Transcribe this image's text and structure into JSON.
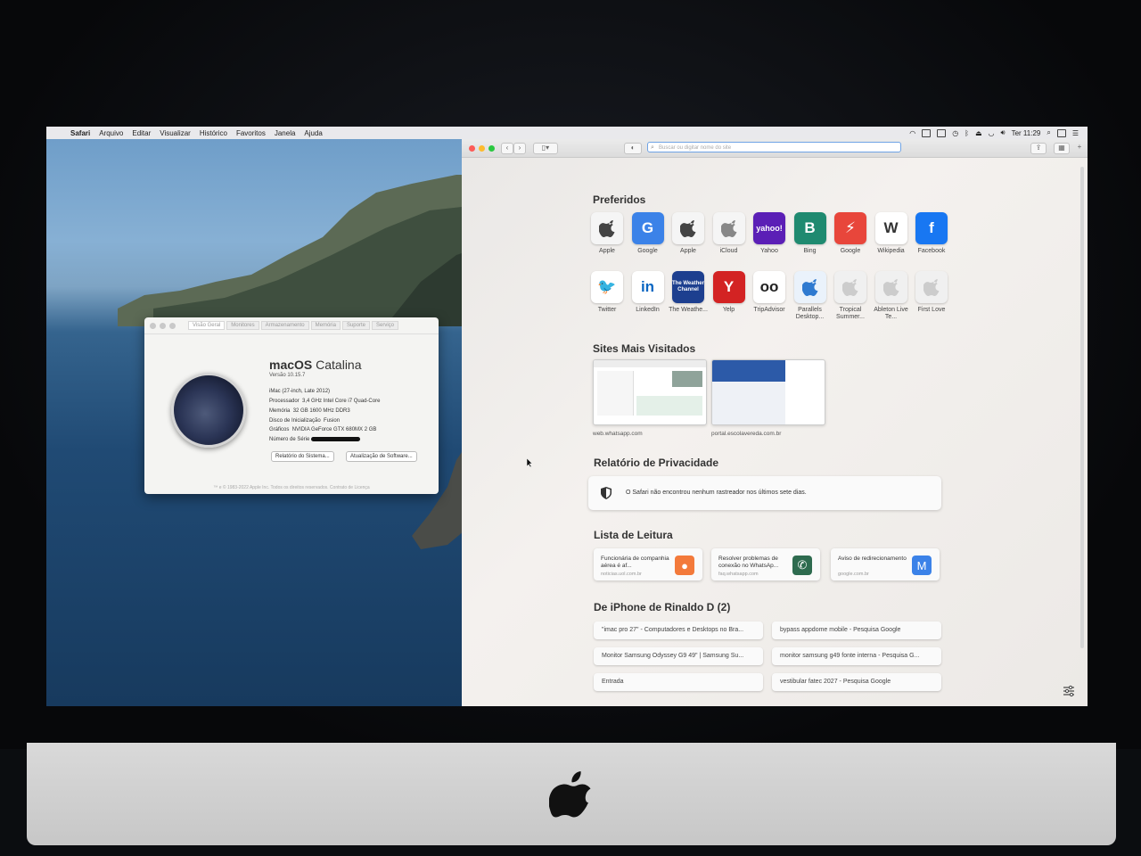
{
  "menubar": {
    "apple_icon": "apple-logo-icon",
    "items": [
      "Safari",
      "Arquivo",
      "Editar",
      "Visualizar",
      "Histórico",
      "Favoritos",
      "Janela",
      "Ajuda"
    ],
    "clock": "Ter 11:29"
  },
  "about": {
    "tabs": [
      "Visão Geral",
      "Monitores",
      "Armazenamento",
      "Memória",
      "Suporte",
      "Serviço"
    ],
    "title_bold": "macOS",
    "title_rest": "Catalina",
    "version": "Versão 10.15.7",
    "model": "iMac (27-inch, Late 2012)",
    "specs": [
      {
        "label": "Processador",
        "value": "3,4 GHz Intel Core i7 Quad-Core"
      },
      {
        "label": "Memória",
        "value": "32 GB 1600 MHz DDR3"
      },
      {
        "label": "Disco de Inicialização",
        "value": "Fusion"
      },
      {
        "label": "Gráficos",
        "value": "NVIDIA GeForce GTX 680MX 2 GB"
      }
    ],
    "serial_label": "Número de Série",
    "btn_report": "Relatório do Sistema...",
    "btn_update": "Atualização de Software...",
    "footer": "™ e © 1983-2022 Apple Inc. Todos os direitos reservados. Contrato de Licença"
  },
  "safari": {
    "url_placeholder": "Buscar ou digitar nome do site",
    "favorites_title": "Preferidos",
    "favorites": [
      {
        "label": "Apple",
        "bg": "#f5f5f5",
        "fg": "#444",
        "glyph": ""
      },
      {
        "label": "Google",
        "bg": "#3b82e8",
        "fg": "#ffffff",
        "glyph": "G"
      },
      {
        "label": "Apple",
        "bg": "#f5f5f5",
        "fg": "#444",
        "glyph": ""
      },
      {
        "label": "iCloud",
        "bg": "#f5f5f5",
        "fg": "#888",
        "glyph": ""
      },
      {
        "label": "Yahoo",
        "bg": "#5b1fb6",
        "fg": "#ffffff",
        "glyph": "yahoo!"
      },
      {
        "label": "Bing",
        "bg": "#1f8a70",
        "fg": "#ffffff",
        "glyph": "B"
      },
      {
        "label": "Google",
        "bg": "#e8463b",
        "fg": "#ffffff",
        "glyph": "⚡"
      },
      {
        "label": "Wikipedia",
        "bg": "#ffffff",
        "fg": "#333",
        "glyph": "W"
      },
      {
        "label": "Facebook",
        "bg": "#1877f2",
        "fg": "#ffffff",
        "glyph": "f"
      },
      {
        "label": "Twitter",
        "bg": "#ffffff",
        "fg": "#1da1f2",
        "glyph": "🐦"
      },
      {
        "label": "LinkedIn",
        "bg": "#ffffff",
        "fg": "#0a66c2",
        "glyph": "in"
      },
      {
        "label": "The Weathe...",
        "bg": "#1d3f8f",
        "fg": "#ffffff",
        "glyph": "The Weather Channel"
      },
      {
        "label": "Yelp",
        "bg": "#d32323",
        "fg": "#ffffff",
        "glyph": "Y"
      },
      {
        "label": "TripAdvisor",
        "bg": "#ffffff",
        "fg": "#222",
        "glyph": "oo"
      },
      {
        "label": "Parallels Desktop...",
        "bg": "#eaf2fb",
        "fg": "#2f7ad0",
        "glyph": ""
      },
      {
        "label": "Tropical Summer...",
        "bg": "#f0f0f0",
        "fg": "#ccc",
        "glyph": ""
      },
      {
        "label": "Ableton Live Te...",
        "bg": "#f0f0f0",
        "fg": "#ccc",
        "glyph": ""
      },
      {
        "label": "First Love",
        "bg": "#f0f0f0",
        "fg": "#ccc",
        "glyph": ""
      }
    ],
    "most_visited_title": "Sites Mais Visitados",
    "most_visited": [
      "web.whatsapp.com",
      "portal.escolavereda.com.br"
    ],
    "privacy_title": "Relatório de Privacidade",
    "privacy_text": "O Safari não encontrou nenhum rastreador nos últimos sete dias.",
    "reading_title": "Lista de Leitura",
    "reading": [
      {
        "title": "Funcionária de companhia aérea é af...",
        "site": "noticias.uol.com.br",
        "bg": "#f37a3b",
        "glyph": "●"
      },
      {
        "title": "Resolver problemas de conexão no WhatsAp...",
        "site": "faq.whatsapp.com",
        "bg": "#2e6b4f",
        "glyph": "✆"
      },
      {
        "title": "Aviso de redirecionamento",
        "site": "google.com.br",
        "bg": "#3b82e8",
        "glyph": "M"
      }
    ],
    "iphone_title": "De iPhone de Rinaldo D (2)",
    "iphone_tabs": [
      "\"imac pro 27\" - Computadores e Desktops no Bra...",
      "bypass appdome mobile - Pesquisa Google",
      "Monitor Samsung Odyssey G9 49\" | Samsung Su...",
      "monitor samsung g49 fonte interna - Pesquisa G...",
      "Entrada",
      "vestibular fatec 2027 - Pesquisa Google"
    ]
  }
}
